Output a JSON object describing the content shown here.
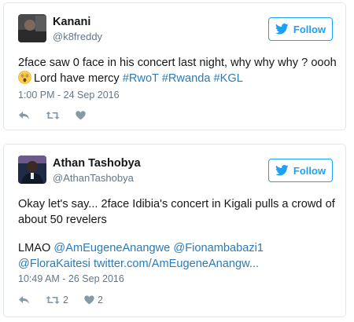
{
  "follow_label": "Follow",
  "colors": {
    "accent": "#1da1f2",
    "link": "#2b7bb9",
    "muted": "#8899a6"
  },
  "tweets": [
    {
      "name": "Kanani",
      "handle": "@k8freddy",
      "text_line1": "2face saw 0 face in his concert last night, why why why ? oooh",
      "emoji": "astonished-face-emoji",
      "text_line2": "Lord have mercy ",
      "hashtags": [
        "#RwoT",
        "#Rwanda",
        "#KGL"
      ],
      "timestamp": "1:00 PM - 24 Sep 2016",
      "actions": {
        "reply_icon": "reply-icon",
        "retweet_icon": "retweet-icon",
        "like_icon": "heart-icon"
      }
    },
    {
      "name": "Athan Tashobya",
      "handle": "@AthanTashobya",
      "text": "Okay let's say... 2face Idibia's concert in Kigali pulls a crowd of about 50 revelers",
      "lmao": "LMAO",
      "mentions": [
        "@AmEugeneAnangwe",
        "@Fionambabazi1",
        "@FloraKaitesi"
      ],
      "link": "twitter.com/AmEugeneAnangw...",
      "timestamp": "10:49 AM - 26 Sep 2016",
      "retweet_count": "2",
      "like_count": "2",
      "actions": {
        "reply_icon": "reply-icon",
        "retweet_icon": "retweet-icon",
        "like_icon": "heart-icon"
      }
    }
  ]
}
